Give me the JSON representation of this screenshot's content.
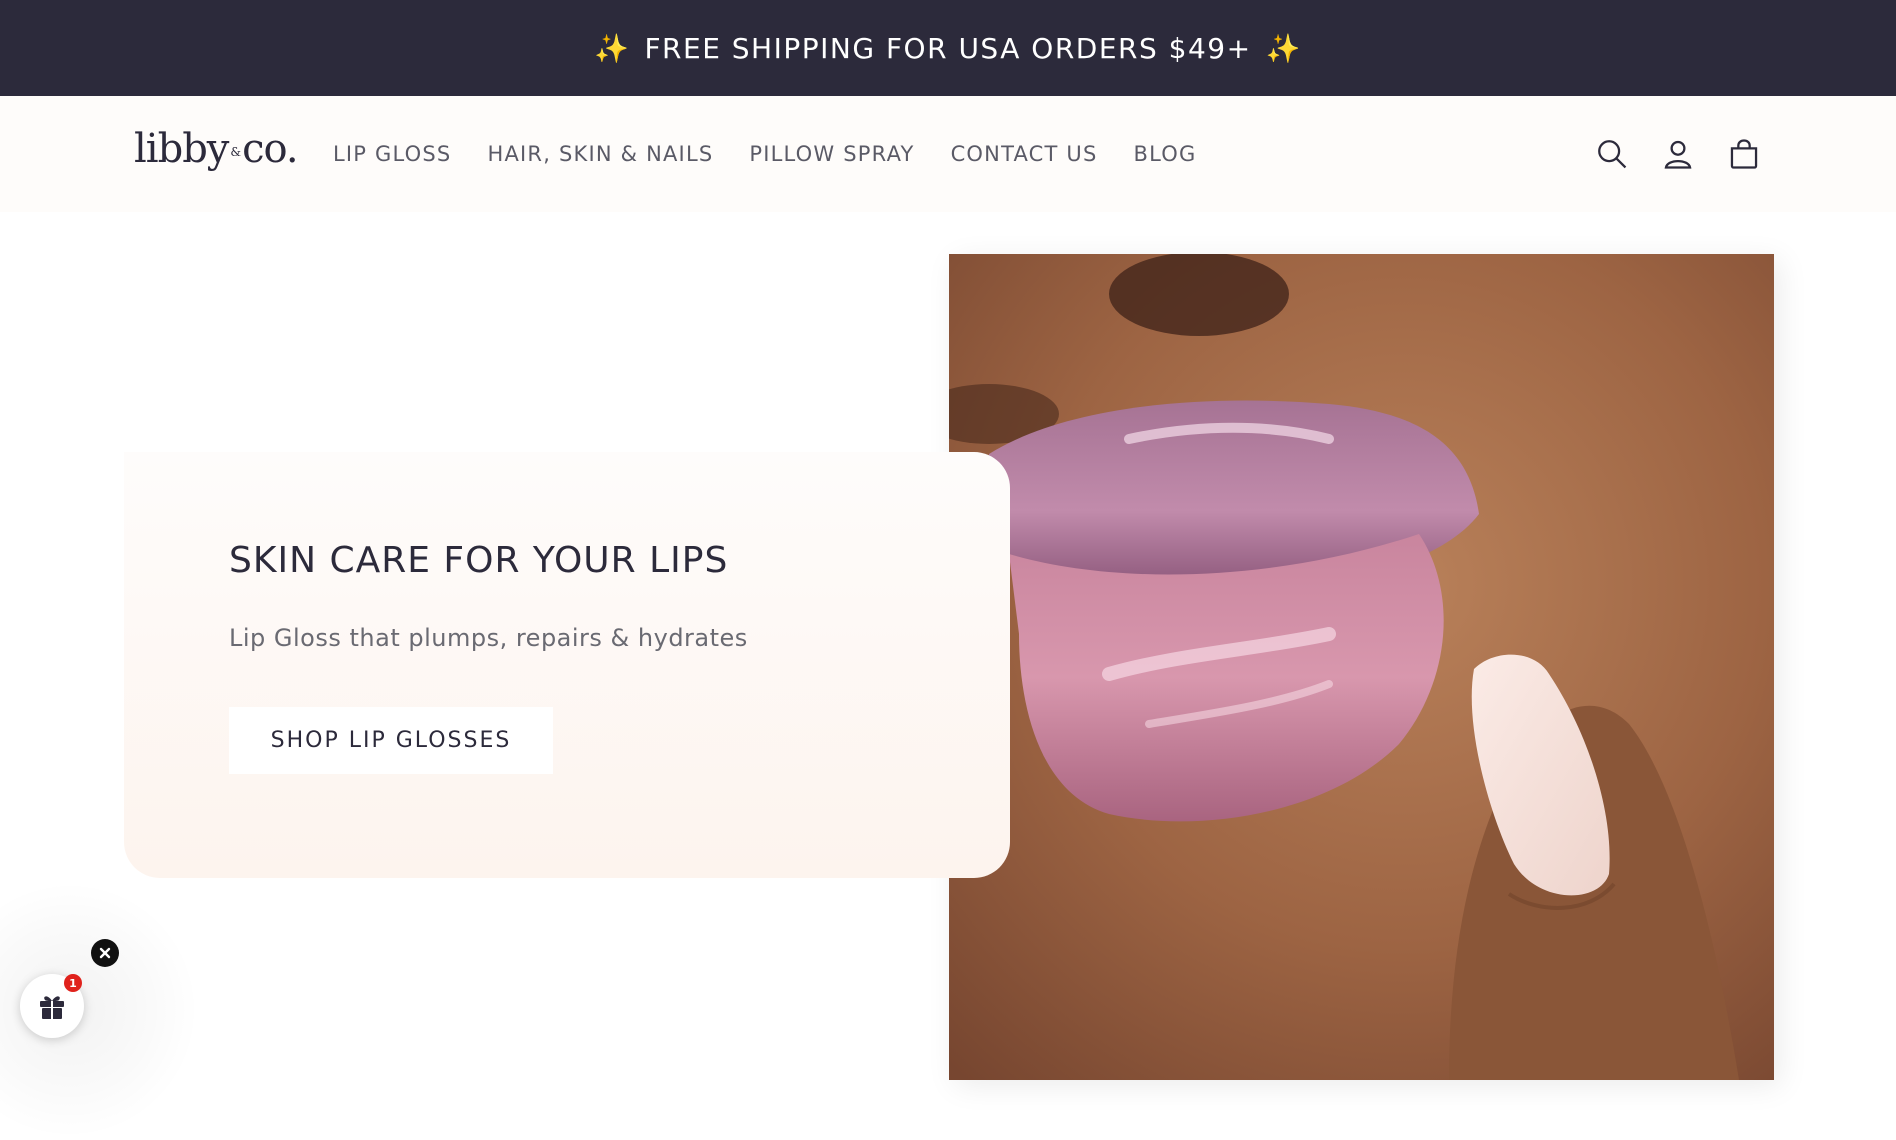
{
  "announcement": {
    "text": "FREE SHIPPING FOR USA ORDERS $49+",
    "emoji": "✨"
  },
  "header": {
    "logo": {
      "main": "libby",
      "amp": "&",
      "suffix": "co."
    },
    "nav": [
      {
        "label": "LIP GLOSS"
      },
      {
        "label": "HAIR, SKIN & NAILS"
      },
      {
        "label": "PILLOW SPRAY"
      },
      {
        "label": "CONTACT US"
      },
      {
        "label": "BLOG"
      }
    ],
    "icons": [
      "search-icon",
      "account-icon",
      "cart-icon"
    ]
  },
  "hero": {
    "title": "SKIN CARE FOR YOUR LIPS",
    "subtitle": "Lip Gloss that plumps, repairs & hydrates",
    "button_label": "SHOP LIP GLOSSES"
  },
  "gift_widget": {
    "badge_count": "1",
    "icons": [
      "gift-icon",
      "close-icon"
    ]
  },
  "colors": {
    "announcement_bg": "#2c2a3b",
    "header_bg": "#fefcfa",
    "text_dark": "#2c2a3b",
    "nav_text": "#5a5a66",
    "card_bg": "#fdf4ee",
    "badge_red": "#e0221c"
  }
}
